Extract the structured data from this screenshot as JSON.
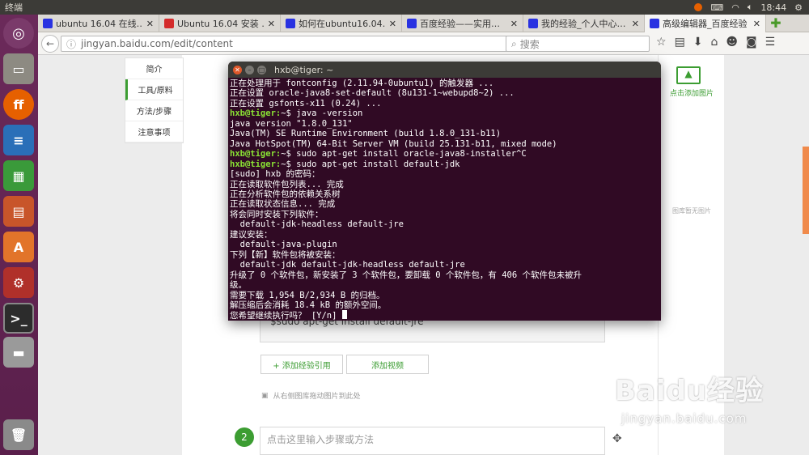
{
  "topbar": {
    "title": "终端",
    "time": "18:44",
    "tray_icons": [
      "firefox-icon",
      "keyboard-icon",
      "wifi-icon",
      "volume-icon"
    ]
  },
  "tabs": [
    {
      "label": "ubuntu 16.04 在线…",
      "color": "#2932e1"
    },
    {
      "label": "Ubuntu 16.04 安装 …",
      "color": "#d42b2b"
    },
    {
      "label": "如何在ubuntu16.04…",
      "color": "#2932e1"
    },
    {
      "label": "百度经验——实用…",
      "color": "#2932e1"
    },
    {
      "label": "我的经验_个人中心…",
      "color": "#2932e1"
    },
    {
      "label": "高级编辑器_百度经验",
      "color": "#2932e1"
    }
  ],
  "navbar": {
    "url": "jingyan.baidu.com/edit/content",
    "search_placeholder": "搜索"
  },
  "sidenav": [
    "简介",
    "工具/原料",
    "方法/步骤",
    "注意事项"
  ],
  "rightpanel": {
    "add_image": "点击添加图片",
    "empty_gallery": "图库暂无图片"
  },
  "terminal": {
    "title": "hxb@tiger: ~",
    "lines": [
      {
        "t": "正在处理用于 fontconfig (2.11.94-0ubuntu1) 的触发器 ..."
      },
      {
        "t": "正在设置 oracle-java8-set-default (8u131-1~webupd8~2) ..."
      },
      {
        "t": "正在设置 gsfonts-x11 (0.24) ..."
      },
      {
        "p": "hxb@tiger:",
        "t": "~$ java -version"
      },
      {
        "t": "java version \"1.8.0_131\""
      },
      {
        "t": "Java(TM) SE Runtime Environment (build 1.8.0_131-b11)"
      },
      {
        "t": "Java HotSpot(TM) 64-Bit Server VM (build 25.131-b11, mixed mode)"
      },
      {
        "p": "hxb@tiger:",
        "t": "~$ sudo apt-get install oracle-java8-installer^C"
      },
      {
        "p": "hxb@tiger:",
        "t": "~$ sudo apt-get install default-jdk"
      },
      {
        "t": "[sudo] hxb 的密码："
      },
      {
        "t": "正在读取软件包列表... 完成"
      },
      {
        "t": "正在分析软件包的依赖关系树"
      },
      {
        "t": "正在读取状态信息... 完成"
      },
      {
        "t": "将会同时安装下列软件："
      },
      {
        "t": "  default-jdk-headless default-jre"
      },
      {
        "t": "建议安装："
      },
      {
        "t": "  default-java-plugin"
      },
      {
        "t": "下列【新】软件包将被安装："
      },
      {
        "t": "  default-jdk default-jdk-headless default-jre"
      },
      {
        "t": "升级了 0 个软件包，新安装了 3 个软件包，要卸载 0 个软件包，有 406 个软件包未被升"
      },
      {
        "t": "级。"
      },
      {
        "t": "需要下载 1,954 B/2,934 B 的归档。"
      },
      {
        "t": "解压缩后会消耗 18.4 kB 的额外空间。"
      },
      {
        "t": "您希望继续执行吗？ [Y/n] "
      }
    ]
  },
  "editor": {
    "code_text": "$sudo apt-get install default-jre",
    "add_ref_button": "+ 添加经验引用",
    "add_video_button": "添加视频",
    "drag_hint": "从右侧图库拖动图片到此处",
    "step_number": "2",
    "step_placeholder": "点击这里输入步骤或方法"
  },
  "watermark": {
    "logo": "Baidu经验",
    "url": "jingyan.baidu.com"
  }
}
